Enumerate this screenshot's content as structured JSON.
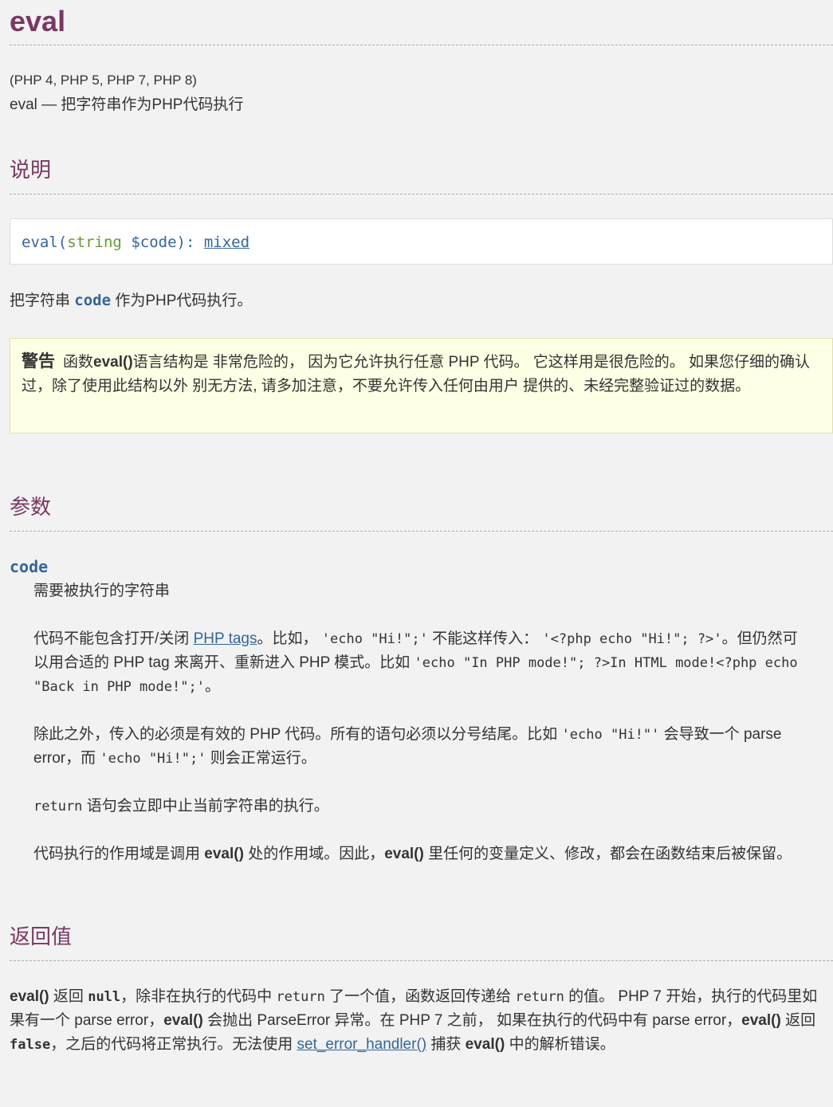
{
  "title": "eval",
  "versions": "(PHP 4, PHP 5, PHP 7, PHP 8)",
  "refpurpose": "eval — 把字符串作为PHP代码执行",
  "sections": {
    "description": "说明",
    "parameters": "参数",
    "return_values": "返回值"
  },
  "synopsis": {
    "func": "eval",
    "open": "(",
    "type": "string",
    "param": "$code",
    "close": "): ",
    "return_type": "mixed"
  },
  "description": {
    "pre": "把字符串 ",
    "param": "code",
    "post": " 作为PHP代码执行。"
  },
  "warning": {
    "title": "警告",
    "t1": "函数",
    "fn": "eval()",
    "t2": "语言结构是 非常危险的， 因为它允许执行任意 PHP 代码。 它这样用是很危险的。 如果您仔细的确认过，除了使用此结构以外 别无方法, 请多加注意，不要允许传入任何由用户 提供的、未经完整验证过的数据。"
  },
  "param": {
    "name": "code",
    "p1": "需要被执行的字符串",
    "p2": {
      "t1": "代码不能包含打开/关闭 ",
      "link": "PHP tags",
      "t2": "。比如， ",
      "c1": "'echo \"Hi!\";'",
      "t3": " 不能这样传入： ",
      "c2": "'<?php echo \"Hi!\"; ?>'",
      "t4": "。但仍然可以用合适的 PHP tag 来离开、重新进入 PHP 模式。比如 ",
      "c3": "'echo \"In PHP mode!\"; ?>In HTML mode!<?php echo \"Back in PHP mode!\";'",
      "t5": "。"
    },
    "p3": {
      "t1": "除此之外，传入的必须是有效的 PHP 代码。所有的语句必须以分号结尾。比如 ",
      "c1": "'echo \"Hi!\"'",
      "t2": " 会导致一个 parse error，而 ",
      "c2": "'echo \"Hi!\";'",
      "t3": " 则会正常运行。"
    },
    "p4": {
      "c1": "return",
      "t1": " 语句会立即中止当前字符串的执行。"
    },
    "p5": {
      "t1": "代码执行的作用域是调用 ",
      "fn1": "eval()",
      "t2": " 处的作用域。因此，",
      "fn2": "eval()",
      "t3": " 里任何的变量定义、修改，都会在函数结束后被保留。"
    }
  },
  "return": {
    "fn1": "eval()",
    "t1": " 返回 ",
    "k1": "null",
    "t2": "，除非在执行的代码中 ",
    "c1": "return",
    "t3": " 了一个值，函数返回传递给 ",
    "c2": "return",
    "t4": " 的值。 PHP 7 开始，执行的代码里如果有一个 parse error，",
    "fn2": "eval()",
    "t5": " 会抛出 ParseError 异常。在 PHP 7 之前， 如果在执行的代码中有 parse error，",
    "fn3": "eval()",
    "t6": " 返回 ",
    "k2": "false",
    "t7": "，之后的代码将正常执行。无法使用 ",
    "link": "set_error_handler()",
    "t8": " 捕获 ",
    "fn4": "eval()",
    "t9": " 中的解析错误。"
  }
}
